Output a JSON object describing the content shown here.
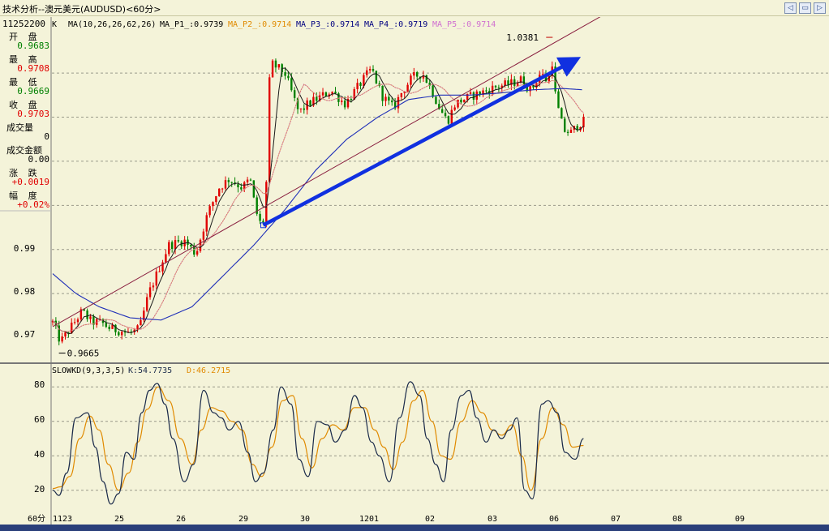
{
  "window": {
    "title": "技术分析--澳元美元(AUDUSD)<60分>"
  },
  "sidebar": {
    "code": "11252200",
    "items": [
      {
        "label": "开 盘",
        "value": "0.9683",
        "color": "#008000"
      },
      {
        "label": "最 高",
        "value": "0.9708",
        "color": "#e00000"
      },
      {
        "label": "最 低",
        "value": "0.9669",
        "color": "#008000"
      },
      {
        "label": "收 盘",
        "value": "0.9703",
        "color": "#e00000"
      },
      {
        "label": "成交量",
        "value": "0",
        "color": "#000000"
      },
      {
        "label": "成交金额",
        "value": "0.00",
        "color": "#000000"
      },
      {
        "label": "涨 跌",
        "value": "+0.0019",
        "color": "#e00000"
      },
      {
        "label": "幅 度",
        "value": "+0.02%",
        "color": "#e00000"
      }
    ]
  },
  "ma_legend": {
    "prefix": "K",
    "params": "MA(10,26,26,62,26)",
    "items": [
      {
        "text": "MA_P1_:0.9739",
        "color": "#000000"
      },
      {
        "text": "MA_P2_:0.9714",
        "color": "#e08a00"
      },
      {
        "text": "MA_P3_:0.9714",
        "color": "#000080"
      },
      {
        "text": "MA_P4_:0.9719",
        "color": "#000080"
      },
      {
        "text": "MA_P5_:0.9714",
        "color": "#d070d0"
      }
    ]
  },
  "kd_legend": {
    "name": "SLOWKD(9,3,3,5)",
    "k": "K:54.7735",
    "d": "D:46.2715",
    "k_color": "#1a2a4a",
    "d_color": "#e08a00"
  },
  "x_axis": {
    "period": "60分",
    "ticks": [
      "1123",
      "25",
      "26",
      "29",
      "30",
      "1201",
      "02",
      "03",
      "06",
      "07",
      "08",
      "09"
    ]
  },
  "chart_data": [
    {
      "type": "candlestick",
      "ylim": [
        0.9655,
        1.0405
      ],
      "y_ticks": [
        "0.97",
        "0.98",
        "0.99"
      ],
      "annotations": [
        {
          "text": "1.0381",
          "kind": "high-marker"
        },
        {
          "text": "0.9665",
          "kind": "low-marker"
        }
      ],
      "anchor_closes": [
        [
          0,
          0.9735
        ],
        [
          10,
          0.969
        ],
        [
          22,
          0.972
        ],
        [
          38,
          0.976
        ],
        [
          50,
          0.9735
        ],
        [
          62,
          0.9735
        ],
        [
          75,
          0.972
        ],
        [
          90,
          0.9715
        ],
        [
          100,
          0.971
        ],
        [
          112,
          0.972
        ],
        [
          124,
          0.98
        ],
        [
          150,
          0.991
        ],
        [
          170,
          0.992
        ],
        [
          185,
          0.989
        ],
        [
          200,
          0.998
        ],
        [
          215,
          1.004
        ],
        [
          228,
          1.006
        ],
        [
          245,
          1.004
        ],
        [
          255,
          1.006
        ],
        [
          262,
          0.999
        ],
        [
          268,
          0.996
        ],
        [
          272,
          0.9965
        ],
        [
          276,
          1.005
        ],
        [
          280,
          1.028
        ],
        [
          284,
          1.032
        ],
        [
          300,
          1.03
        ],
        [
          318,
          1.021
        ],
        [
          330,
          1.023
        ],
        [
          345,
          1.0245
        ],
        [
          360,
          1.026
        ],
        [
          378,
          1.023
        ],
        [
          395,
          1.027
        ],
        [
          412,
          1.031
        ],
        [
          425,
          1.025
        ],
        [
          440,
          1.022
        ],
        [
          452,
          1.026
        ],
        [
          465,
          1.029
        ],
        [
          478,
          1.03
        ],
        [
          490,
          1.026
        ],
        [
          500,
          1.022
        ],
        [
          510,
          1.019
        ],
        [
          520,
          1.023
        ],
        [
          530,
          1.024
        ],
        [
          545,
          1.025
        ],
        [
          560,
          1.026
        ],
        [
          575,
          1.027
        ],
        [
          590,
          1.0275
        ],
        [
          605,
          1.0285
        ],
        [
          618,
          1.026
        ],
        [
          630,
          1.03
        ],
        [
          640,
          1.028
        ],
        [
          646,
          1.033
        ],
        [
          650,
          1.024
        ],
        [
          660,
          1.017
        ],
        [
          670,
          1.0165
        ],
        [
          680,
          1.0185
        ],
        [
          686,
          1.019
        ]
      ],
      "ma_long_anchors": [
        [
          0,
          0.9845
        ],
        [
          30,
          0.98
        ],
        [
          60,
          0.977
        ],
        [
          100,
          0.9745
        ],
        [
          140,
          0.974
        ],
        [
          180,
          0.977
        ],
        [
          220,
          0.984
        ],
        [
          260,
          0.991
        ],
        [
          300,
          0.999
        ],
        [
          340,
          1.008
        ],
        [
          380,
          1.015
        ],
        [
          420,
          1.02
        ],
        [
          460,
          1.024
        ],
        [
          500,
          1.025
        ],
        [
          540,
          1.025
        ],
        [
          580,
          1.0255
        ],
        [
          620,
          1.0262
        ],
        [
          660,
          1.0265
        ],
        [
          686,
          1.0262
        ]
      ],
      "trendline_thin": [
        [
          0,
          0.9725
        ],
        [
          730,
          1.045
        ]
      ],
      "trendline_thick": [
        [
          272,
          0.9955
        ],
        [
          670,
          1.0325
        ]
      ]
    },
    {
      "type": "line",
      "title": "SLOWKD(9,3,3,5)",
      "ylim": [
        10,
        90
      ],
      "y_ticks": [
        20,
        40,
        60,
        80
      ],
      "series": [
        {
          "name": "K",
          "points": [
            [
              0,
              20
            ],
            [
              8,
              17
            ],
            [
              18,
              30
            ],
            [
              30,
              62
            ],
            [
              45,
              65
            ],
            [
              55,
              45
            ],
            [
              65,
              25
            ],
            [
              75,
              12
            ],
            [
              85,
              18
            ],
            [
              95,
              42
            ],
            [
              105,
              38
            ],
            [
              115,
              65
            ],
            [
              125,
              78
            ],
            [
              135,
              82
            ],
            [
              145,
              70
            ],
            [
              155,
              50
            ],
            [
              170,
              25
            ],
            [
              182,
              35
            ],
            [
              195,
              78
            ],
            [
              208,
              65
            ],
            [
              218,
              62
            ],
            [
              228,
              55
            ],
            [
              240,
              60
            ],
            [
              252,
              42
            ],
            [
              262,
              25
            ],
            [
              272,
              30
            ],
            [
              285,
              55
            ],
            [
              295,
              80
            ],
            [
              308,
              70
            ],
            [
              318,
              38
            ],
            [
              330,
              28
            ],
            [
              342,
              60
            ],
            [
              355,
              58
            ],
            [
              365,
              48
            ],
            [
              378,
              55
            ],
            [
              390,
              75
            ],
            [
              400,
              68
            ],
            [
              412,
              48
            ],
            [
              422,
              40
            ],
            [
              435,
              25
            ],
            [
              448,
              62
            ],
            [
              462,
              83
            ],
            [
              474,
              75
            ],
            [
              484,
              50
            ],
            [
              495,
              35
            ],
            [
              505,
              25
            ],
            [
              515,
              55
            ],
            [
              528,
              75
            ],
            [
              538,
              78
            ],
            [
              548,
              62
            ],
            [
              560,
              48
            ],
            [
              570,
              55
            ],
            [
              580,
              50
            ],
            [
              590,
              55
            ],
            [
              600,
              62
            ],
            [
              610,
              20
            ],
            [
              620,
              15
            ],
            [
              632,
              70
            ],
            [
              640,
              72
            ],
            [
              652,
              65
            ],
            [
              662,
              42
            ],
            [
              675,
              38
            ],
            [
              686,
              50
            ]
          ]
        },
        {
          "name": "D",
          "points": [
            [
              0,
              21
            ],
            [
              10,
              22
            ],
            [
              22,
              28
            ],
            [
              35,
              50
            ],
            [
              48,
              63
            ],
            [
              60,
              55
            ],
            [
              72,
              35
            ],
            [
              85,
              20
            ],
            [
              98,
              30
            ],
            [
              110,
              48
            ],
            [
              122,
              67
            ],
            [
              136,
              80
            ],
            [
              150,
              72
            ],
            [
              165,
              50
            ],
            [
              180,
              35
            ],
            [
              192,
              55
            ],
            [
              205,
              68
            ],
            [
              218,
              66
            ],
            [
              232,
              60
            ],
            [
              245,
              55
            ],
            [
              258,
              35
            ],
            [
              270,
              28
            ],
            [
              283,
              45
            ],
            [
              297,
              72
            ],
            [
              310,
              75
            ],
            [
              322,
              50
            ],
            [
              335,
              33
            ],
            [
              348,
              50
            ],
            [
              362,
              58
            ],
            [
              375,
              55
            ],
            [
              390,
              68
            ],
            [
              403,
              68
            ],
            [
              416,
              55
            ],
            [
              428,
              45
            ],
            [
              440,
              32
            ],
            [
              452,
              48
            ],
            [
              466,
              72
            ],
            [
              478,
              78
            ],
            [
              490,
              60
            ],
            [
              502,
              40
            ],
            [
              514,
              38
            ],
            [
              528,
              60
            ],
            [
              542,
              72
            ],
            [
              555,
              65
            ],
            [
              568,
              55
            ],
            [
              580,
              52
            ],
            [
              594,
              58
            ],
            [
              606,
              40
            ],
            [
              618,
              20
            ],
            [
              632,
              50
            ],
            [
              646,
              68
            ],
            [
              660,
              58
            ],
            [
              672,
              45
            ],
            [
              686,
              46
            ]
          ]
        }
      ]
    }
  ]
}
